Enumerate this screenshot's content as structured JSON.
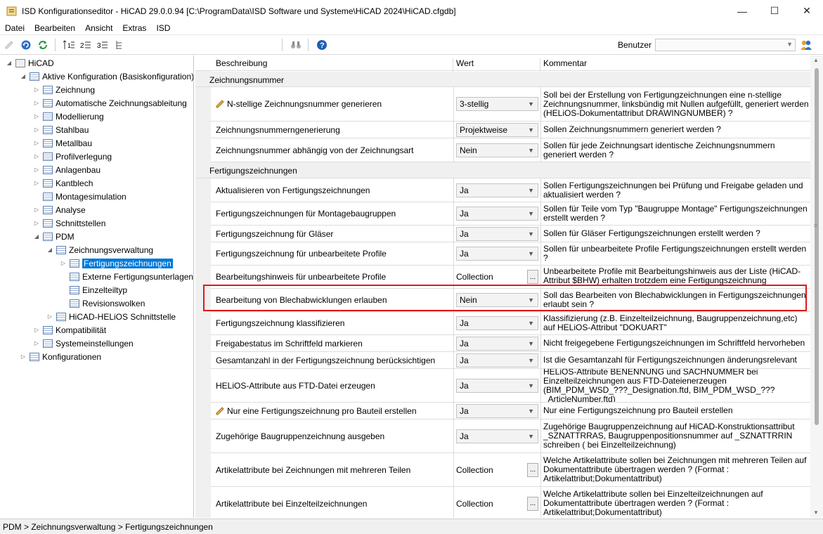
{
  "window": {
    "title": "ISD Konfigurationseditor - HiCAD 29.0.0.94 [C:\\ProgramData\\ISD Software und Systeme\\HiCAD 2024\\HiCAD.cfgdb]",
    "minimize": "—",
    "maximize": "☐",
    "close": "✕"
  },
  "menu": [
    "Datei",
    "Bearbeiten",
    "Ansicht",
    "Extras",
    "ISD"
  ],
  "toolbar": {
    "user_label": "Benutzer",
    "user_value": ""
  },
  "tree": {
    "root": "HiCAD",
    "active": "Aktive Konfiguration (Basiskonfiguration)",
    "items": [
      "Zeichnung",
      "Automatische Zeichnungsableitung",
      "Modellierung",
      "Stahlbau",
      "Metallbau",
      "Profilverlegung",
      "Anlagenbau",
      "Kantblech",
      "Montagesimulation",
      "Analyse",
      "Schnittstellen",
      "PDM"
    ],
    "pdm_child": "Zeichnungsverwaltung",
    "zv_children": [
      "Fertigungszeichnungen",
      "Externe Fertigungsunterlagen",
      "Einzelteiltyp",
      "Revisionswolken"
    ],
    "pdm_child2": "HiCAD-HELiOS Schnittstelle",
    "bottom": [
      "Kompatibilität",
      "Systemeinstellungen"
    ],
    "configs": "Konfigurationen"
  },
  "grid": {
    "headers": {
      "desc": "Beschreibung",
      "value": "Wert",
      "comment": "Kommentar"
    },
    "group1": "Zeichnungsnummer",
    "rows1": [
      {
        "desc": "N-stellige Zeichnungsnummer generieren",
        "value": "3-stellig",
        "comment": "Soll bei der Erstellung von Fertigungzeichnungen eine n-stellige Zeichnungsnummer, linksbündig mit Nullen aufgefüllt, generiert werden (HELiOS-Dokumentattribut DRAWINGNUMBER) ?"
      },
      {
        "desc": "Zeichnungsnummerngenerierung",
        "value": "Projektweise",
        "comment": "Sollen Zeichnungsnummern generiert werden ?"
      },
      {
        "desc": "Zeichnungsnummer abhängig von der Zeichnungsart",
        "value": "Nein",
        "comment": "Sollen für jede Zeichnungsart identische Zeichnungsnummern generiert werden ?"
      }
    ],
    "group2": "Fertigungszeichnungen",
    "rows2": [
      {
        "desc": "Aktualisieren von Fertigungszeichnungen",
        "value": "Ja",
        "comment": "Sollen Fertigungszeichnungen bei Prüfung und Freigabe geladen und aktualisiert werden ?"
      },
      {
        "desc": "Fertigungszeichnungen für Montagebaugruppen",
        "value": "Ja",
        "comment": "Sollen für Teile vom Typ \"Baugruppe Montage\" Fertigungszeichnungen erstellt werden ?"
      },
      {
        "desc": "Fertigungszeichnung für Gläser",
        "value": "Ja",
        "comment": "Sollen für Gläser Fertigungszeichnungen erstellt werden ?"
      },
      {
        "desc": "Fertigungszeichnung für unbearbeitete Profile",
        "value": "Ja",
        "comment": "Sollen für unbearbeitete Profile Fertigungszeichnungen erstellt werden ?"
      },
      {
        "desc": "Bearbeitungshinweis für unbearbeitete Profile",
        "value": "Collection",
        "comment": "Unbearbeitete Profile mit Bearbeitungshinweis aus der Liste (HiCAD-Attribut $BHW) erhalten trotzdem eine Fertigungszeichnung"
      },
      {
        "desc": "Bearbeitung von Blechabwicklungen erlauben",
        "value": "Nein",
        "comment": "Soll das Bearbeiten von Blechabwicklungen in Fertigungszeichnungen erlaubt sein ?"
      },
      {
        "desc": "Fertigungszeichnung klassifizieren",
        "value": "Ja",
        "comment": "Klassifizierung (z.B. Einzelteilzeichnung, Baugruppenzeichnung,etc) auf HELiOS-Attribut \"DOKUART\""
      },
      {
        "desc": "Freigabestatus im Schriftfeld markieren",
        "value": "Ja",
        "comment": "Nicht freigegebene Fertigungszeichnungen im Schriftfeld hervorheben"
      },
      {
        "desc": "Gesamtanzahl in der Fertigungszeichnung berücksichtigen",
        "value": "Ja",
        "comment": "Ist die Gesamtanzahl für Fertigungszeichnungen änderungsrelevant"
      },
      {
        "desc": "HELiOS-Attribute aus FTD-Datei erzeugen",
        "value": "Ja",
        "comment": "HELiOS-Attribute BENENNUNG und SACHNUMMER bei Einzelteilzeichnungen aus FTD-Dateienerzeugen (BIM_PDM_WSD_???_Designation.ftd, BIM_PDM_WSD_???_ArticleNumber.ftd)"
      },
      {
        "desc": "Nur eine Fertigungszeichnung pro Bauteil erstellen",
        "value": "Ja",
        "comment": "Nur eine Fertigungszeichnung pro Bauteil erstellen"
      },
      {
        "desc": "Zugehörige Baugruppenzeichnung ausgeben",
        "value": "Ja",
        "comment": "Zugehörige Baugruppenzeichnung auf HiCAD-Konstruktionsattribut _SZNATTRRAS, Baugruppenpositionsnummer auf _SZNATTRRIN schreiben ( bei Einzelteilzeichnung)"
      },
      {
        "desc": "Artikelattribute bei Zeichnungen mit mehreren Teilen",
        "value": "Collection",
        "comment": "Welche Artikelattribute sollen bei Zeichnungen mit mehreren Teilen auf Dokumentattribute übertragen werden ?  (Format : Artikelattribut;Dokumentattribut)"
      },
      {
        "desc": "Artikelattribute bei Einzelteilzeichnungen",
        "value": "Collection",
        "comment": "Welche Artikelattribute sollen bei Einzelteilzeichnungen auf Dokumentattribute übertragen werden ?  (Format : Artikelattribut;Dokumentattribut)"
      }
    ],
    "collection_button": "..."
  },
  "statusbar": {
    "breadcrumb": "PDM > Zeichnungsverwaltung > Fertigungszeichnungen"
  },
  "colors": {
    "selection": "#0078d7",
    "highlight": "#e01818",
    "group_bg": "#f0f0f0"
  }
}
